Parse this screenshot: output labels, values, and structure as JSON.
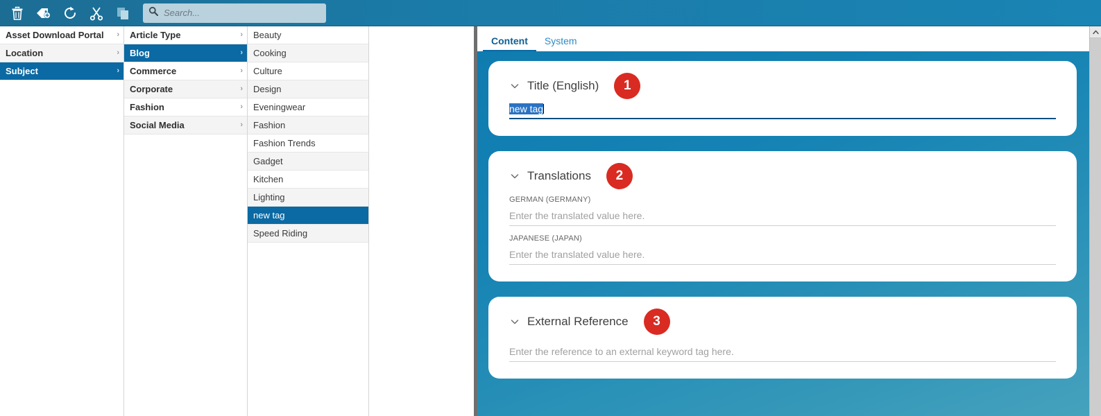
{
  "toolbar": {
    "buttons": [
      {
        "name": "delete-icon",
        "tooltip": "Delete"
      },
      {
        "name": "add-tag-icon",
        "tooltip": "Add Tag"
      },
      {
        "name": "refresh-icon",
        "tooltip": "Refresh"
      },
      {
        "name": "cut-icon",
        "tooltip": "Cut"
      },
      {
        "name": "copy-icon",
        "tooltip": "Copy"
      }
    ],
    "search": {
      "placeholder": "Search...",
      "value": ""
    }
  },
  "browser": {
    "columns": [
      {
        "name": "root-column",
        "items": [
          {
            "label": "Asset Download Portal",
            "selected": false,
            "bold": true,
            "chevron": "›"
          },
          {
            "label": "Location",
            "selected": false,
            "bold": true,
            "chevron": "›"
          },
          {
            "label": "Subject",
            "selected": true,
            "bold": true,
            "chevron": "›"
          }
        ]
      },
      {
        "name": "subject-column",
        "items": [
          {
            "label": "Article Type",
            "selected": false,
            "bold": true,
            "chevron": "›"
          },
          {
            "label": "Blog",
            "selected": true,
            "bold": true,
            "chevron": "›"
          },
          {
            "label": "Commerce",
            "selected": false,
            "bold": true,
            "chevron": "›"
          },
          {
            "label": "Corporate",
            "selected": false,
            "bold": true,
            "chevron": "›"
          },
          {
            "label": "Fashion",
            "selected": false,
            "bold": true,
            "chevron": "›"
          },
          {
            "label": "Social Media",
            "selected": false,
            "bold": true,
            "chevron": "›"
          }
        ]
      },
      {
        "name": "blog-column",
        "items": [
          {
            "label": "Beauty",
            "selected": false,
            "bold": false,
            "chevron": ""
          },
          {
            "label": "Cooking",
            "selected": false,
            "bold": false,
            "chevron": ""
          },
          {
            "label": "Culture",
            "selected": false,
            "bold": false,
            "chevron": ""
          },
          {
            "label": "Design",
            "selected": false,
            "bold": false,
            "chevron": ""
          },
          {
            "label": "Eveningwear",
            "selected": false,
            "bold": false,
            "chevron": ""
          },
          {
            "label": "Fashion",
            "selected": false,
            "bold": false,
            "chevron": ""
          },
          {
            "label": "Fashion Trends",
            "selected": false,
            "bold": false,
            "chevron": ""
          },
          {
            "label": "Gadget",
            "selected": false,
            "bold": false,
            "chevron": ""
          },
          {
            "label": "Kitchen",
            "selected": false,
            "bold": false,
            "chevron": ""
          },
          {
            "label": "Lighting",
            "selected": false,
            "bold": false,
            "chevron": ""
          },
          {
            "label": "new tag",
            "selected": true,
            "bold": false,
            "chevron": ""
          },
          {
            "label": "Speed Riding",
            "selected": false,
            "bold": false,
            "chevron": ""
          }
        ]
      },
      {
        "name": "empty-column",
        "items": []
      }
    ]
  },
  "detail": {
    "tabs": [
      {
        "label": "Content",
        "active": true
      },
      {
        "label": "System",
        "active": false
      }
    ],
    "cards": [
      {
        "name": "title-card",
        "title": "Title (English)",
        "badge": "1",
        "value": "new tag",
        "selected_text": "new tag",
        "placeholder": ""
      },
      {
        "name": "translations-card",
        "title": "Translations",
        "badge": "2",
        "fields": [
          {
            "label": "GERMAN (GERMANY)",
            "value": "",
            "placeholder": "Enter the translated value here."
          },
          {
            "label": "JAPANESE (JAPAN)",
            "value": "",
            "placeholder": "Enter the translated value here."
          }
        ]
      },
      {
        "name": "external-reference-card",
        "title": "External Reference",
        "badge": "3",
        "value": "",
        "placeholder": "Enter the reference to an external keyword tag here."
      }
    ]
  },
  "scrollbar": {
    "up_arrow": "⌃"
  },
  "colors": {
    "toolbar_blue": "#1a7ba8",
    "selection_blue": "#0b69a3",
    "panel_blue_top": "#0f7bb0",
    "panel_blue_bottom": "#46a2bd",
    "badge_red": "#d92b22",
    "tab_active": "#0e5f94",
    "tab_inactive": "#2e8bc4",
    "field_focus_underline": "#0b4f80",
    "text_selection": "#2a72c4"
  }
}
